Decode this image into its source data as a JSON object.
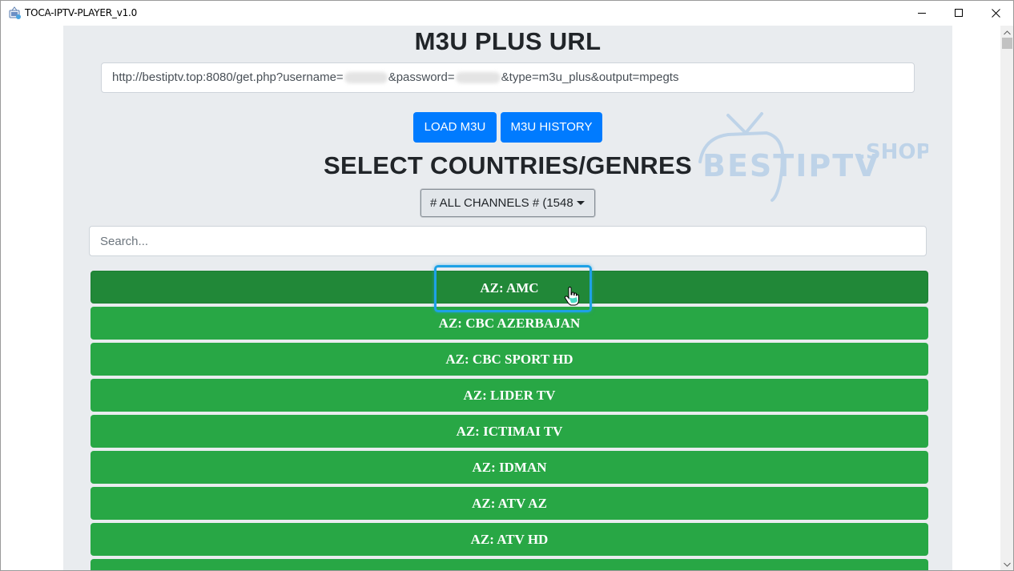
{
  "window": {
    "title": "TOCA-IPTV-PLAYER_v1.0"
  },
  "header": {
    "m3u_heading": "M3U PLUS URL",
    "url_prefix": "http://bestiptv.top:8080/get.php?username=",
    "url_password_param": "&password=",
    "url_suffix": "&type=m3u_plus&output=mpegts"
  },
  "buttons": {
    "load_label": "LOAD M3U",
    "history_label": "M3U HISTORY"
  },
  "selector": {
    "heading": "SELECT COUNTRIES/GENRES",
    "selected_value": "# ALL CHANNELS # (1548"
  },
  "search": {
    "placeholder": "Search..."
  },
  "channels": [
    {
      "label": "AZ: AMC"
    },
    {
      "label": "AZ: CBC AZERBAJAN"
    },
    {
      "label": "AZ: CBC SPORT HD"
    },
    {
      "label": "AZ: LIDER TV"
    },
    {
      "label": "AZ: ICTIMAI TV"
    },
    {
      "label": "AZ: IDMAN"
    },
    {
      "label": "AZ: ATV AZ"
    },
    {
      "label": "AZ: ATV HD"
    }
  ],
  "colors": {
    "primary": "#007bff",
    "channel_green": "#28a745",
    "channel_active": "#218838",
    "highlight": "#1ea1e6",
    "panel_bg": "#e9ecef"
  },
  "watermark": {
    "brand_text": "BESTIPTV",
    "brand_suffix": ".SHOP"
  }
}
